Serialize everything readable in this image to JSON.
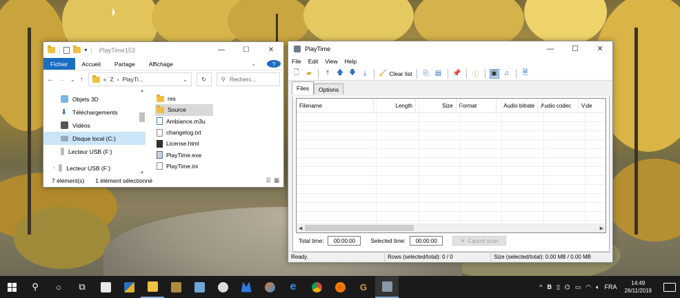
{
  "explorer": {
    "title": "PlayTime153",
    "ribbon_tabs": [
      "Fichier",
      "Accueil",
      "Partage",
      "Affichage"
    ],
    "help": "?",
    "address": {
      "prefix": "«",
      "drive": "Z",
      "sep": "›",
      "current": "PlayTi..."
    },
    "search_placeholder": "Recherc...",
    "nav_items": [
      {
        "label": "Objets 3D",
        "icon": "cube-3d-icon"
      },
      {
        "label": "Téléchargements",
        "icon": "download-arrow-icon"
      },
      {
        "label": "Vidéos",
        "icon": "video-film-icon"
      },
      {
        "label": "Disque local (C:)",
        "icon": "hard-drive-icon"
      },
      {
        "label": "Lecteur USB (F:)",
        "icon": "usb-drive-icon"
      },
      {
        "label": "Lecteur USB (F:)",
        "icon": "usb-drive-icon"
      }
    ],
    "files": [
      {
        "name": "res",
        "icon": "folder-icon"
      },
      {
        "name": "Source",
        "icon": "folder-icon"
      },
      {
        "name": "Ambiance.m3u",
        "icon": "playlist-file-icon"
      },
      {
        "name": "changelog.txt",
        "icon": "text-file-icon"
      },
      {
        "name": "License.html",
        "icon": "html-file-icon"
      },
      {
        "name": "PlayTime.exe",
        "icon": "exe-file-icon"
      },
      {
        "name": "PlayTime.ini",
        "icon": "ini-file-icon"
      }
    ],
    "status_count": "7 élément(s)",
    "status_selected": "1 élément sélectionné"
  },
  "playtime": {
    "title": "PlayTime",
    "menu": [
      "File",
      "Edit",
      "View",
      "Help"
    ],
    "clear_list_label": "Clear list",
    "tabs": [
      "Files",
      "Options"
    ],
    "columns": [
      "Filename",
      "Length",
      "Size",
      "Format",
      "Audio bitrate",
      "Audio codec",
      "Vide"
    ],
    "total_time_label": "Total time:",
    "total_time_value": "00:00:00",
    "selected_time_label": "Selected time:",
    "selected_time_value": "00:00:00",
    "cancel_scan_label": "Cancel scan",
    "status_ready": "Ready.",
    "status_rows": "Rows (selected/total): 0 / 0",
    "status_size": "Size (selected/total): 0.00 MB / 0.00 MB"
  },
  "taskbar": {
    "lang": "FRA",
    "time": "14:49",
    "date": "26/11/2019"
  },
  "colors": {
    "accent": "#1a6dc1",
    "selection": "#cce4f7",
    "taskbar": "#1a1a1a"
  }
}
